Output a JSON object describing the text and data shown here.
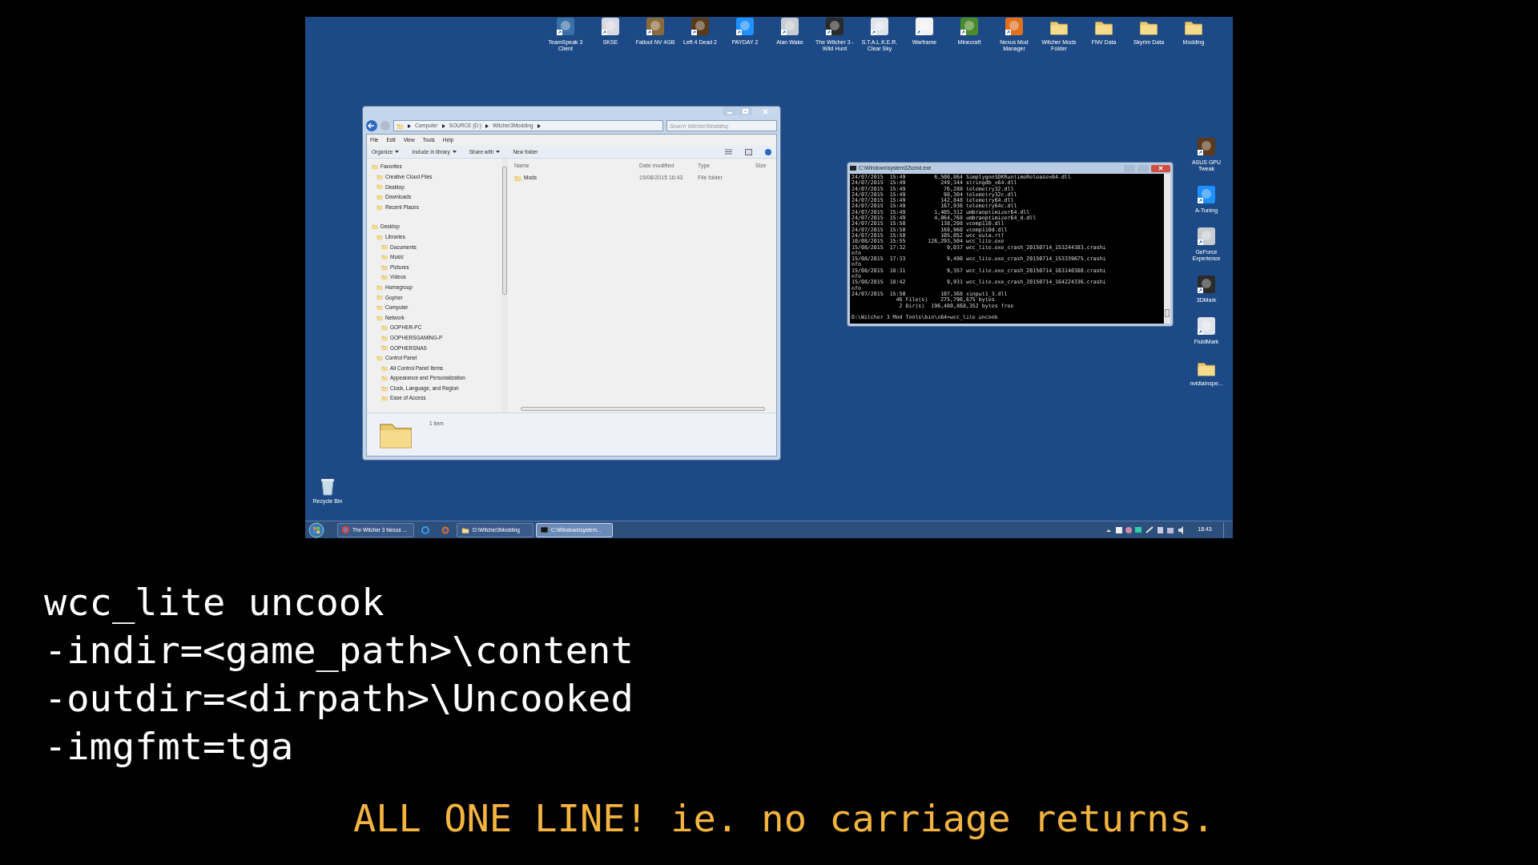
{
  "desktop": {
    "icons_top": [
      {
        "label": "TeamSpeak 3 Client",
        "kind": "app"
      },
      {
        "label": "SKSE",
        "kind": "app"
      },
      {
        "label": "Fallout NV 4GB",
        "kind": "app"
      },
      {
        "label": "Left 4 Dead 2",
        "kind": "app"
      },
      {
        "label": "PAYDAY 2",
        "kind": "app"
      },
      {
        "label": "Alan Wake",
        "kind": "app"
      },
      {
        "label": "The Witcher 3 - Wild Hunt",
        "kind": "app"
      },
      {
        "label": "S.T.A.L.K.E.R. Clear Sky",
        "kind": "app"
      },
      {
        "label": "Warframe",
        "kind": "app"
      },
      {
        "label": "Minecraft",
        "kind": "app"
      },
      {
        "label": "Nexus Mod Manager",
        "kind": "app"
      },
      {
        "label": "Witcher Mods Folder",
        "kind": "folder"
      },
      {
        "label": "FNV Data",
        "kind": "folder"
      },
      {
        "label": "Skyrim Data",
        "kind": "folder"
      },
      {
        "label": "Modding",
        "kind": "folder"
      }
    ],
    "icons_right": [
      {
        "label": "ASUS GPU Tweak",
        "kind": "app"
      },
      {
        "label": "A-Tuning",
        "kind": "app"
      },
      {
        "label": "GeForce Experience",
        "kind": "app"
      },
      {
        "label": "3DMark",
        "kind": "app"
      },
      {
        "label": "FluidMark",
        "kind": "app"
      },
      {
        "label": "nvidiaInspe...",
        "kind": "folder"
      }
    ],
    "recycle_bin": {
      "label": "Recycle Bin"
    },
    "explorer": {
      "breadcrumb": [
        "Computer",
        "SOURCE (D:)",
        "Witcher3Modding"
      ],
      "search": {
        "placeholder": "Search Witcher3Modding"
      },
      "menu": [
        "File",
        "Edit",
        "View",
        "Tools",
        "Help"
      ],
      "toolbar": [
        "Organize",
        "Include in library",
        "Share with",
        "New folder"
      ],
      "nav": [
        {
          "label": "Favorites",
          "children": [
            {
              "label": "Creative Cloud Files"
            },
            {
              "label": "Desktop"
            },
            {
              "label": "Downloads"
            },
            {
              "label": "Recent Places"
            }
          ]
        },
        {
          "label": "Desktop",
          "children": [
            {
              "label": "Libraries",
              "children": [
                {
                  "label": "Documents"
                },
                {
                  "label": "Music"
                },
                {
                  "label": "Pictures"
                },
                {
                  "label": "Videos"
                }
              ]
            },
            {
              "label": "Homegroup"
            },
            {
              "label": "Gopher"
            },
            {
              "label": "Computer"
            },
            {
              "label": "Network",
              "children": [
                {
                  "label": "GOPHER-PC"
                },
                {
                  "label": "GOPHERSGAMING-P"
                },
                {
                  "label": "GOPHERSNAS"
                }
              ]
            },
            {
              "label": "Control Panel",
              "children": [
                {
                  "label": "All Control Panel Items"
                },
                {
                  "label": "Appearance and Personalization"
                },
                {
                  "label": "Clock, Language, and Region"
                },
                {
                  "label": "Ease of Access"
                }
              ]
            }
          ]
        }
      ],
      "columns": [
        "Name",
        "Date modified",
        "Type",
        "Size"
      ],
      "rows": [
        {
          "name": "Mods",
          "date": "15/08/2015 16:43",
          "type": "File folder"
        }
      ],
      "status": "1 item"
    },
    "cmd": {
      "title": "C:\\Windows\\system32\\cmd.exe",
      "lines": [
        "24/07/2015  15:49         6,500,864 SimplygonSDKRuntimeReleasex64.dll",
        "24/07/2015  15:49           249,344 stringdb_x64.dll",
        "24/07/2015  15:49            76,288 telemetry32.dll",
        "24/07/2015  15:49            98,304 telemetry32c.dll",
        "24/07/2015  15:49           142,848 telemetry64.dll",
        "24/07/2015  15:49           167,936 telemetry64c.dll",
        "24/07/2015  15:49         1,405,312 umbraoptimizer64.dll",
        "24/07/2015  15:49         4,064,768 umbraoptimizer64_d.dll",
        "24/07/2015  15:50           138,208 vcomp110.dll",
        "24/07/2015  15:50           169,960 vcomp110d.dll",
        "24/07/2015  15:50           105,052 wcc_eula.rtf",
        "10/08/2015  15:55       126,293,504 wcc_lite.exe",
        "15/08/2015  17:32             9,037 wcc_lite.exe_crash_20150714_153244383.crashi",
        "nfo",
        "15/08/2015  17:33             9,490 wcc_lite.exe_crash_20150714_153339675.crashi",
        "nfo",
        "15/08/2015  18:31             9,357 wcc_lite.exe_crash_20150714_163140380.crashi",
        "nfo",
        "15/08/2015  18:42             9,931 wcc_lite.exe_crash_20150714_164224336.crashi",
        "nfo",
        "24/07/2015  15:50           107,368 xinput1_3.dll",
        "              46 File(s)    275,796,675 bytes",
        "               2 Dir(s)  196,480,868,352 bytes free"
      ],
      "prompt": "D:\\Witcher 3 Mod Tools\\bin\\x64>wcc_lite uncook"
    },
    "taskbar": {
      "buttons": [
        {
          "label": "The Witcher 3 Nexus ...",
          "kind": "browser",
          "selected": false
        },
        {
          "kind": "ie",
          "selected": false
        },
        {
          "kind": "firefox",
          "selected": false
        },
        {
          "label": "D:\\Witcher3Modding",
          "kind": "folder",
          "selected": false
        },
        {
          "label": "C:\\Windows\\system...",
          "kind": "console",
          "selected": true
        }
      ],
      "clock": "18:43"
    }
  },
  "caption": {
    "command_lines": [
      "wcc_lite uncook",
      "-indir=<game_path>\\content",
      "-outdir=<dirpath>\\Uncooked",
      "-imgfmt=tga"
    ],
    "note": "ALL ONE LINE! ie. no carriage returns."
  }
}
